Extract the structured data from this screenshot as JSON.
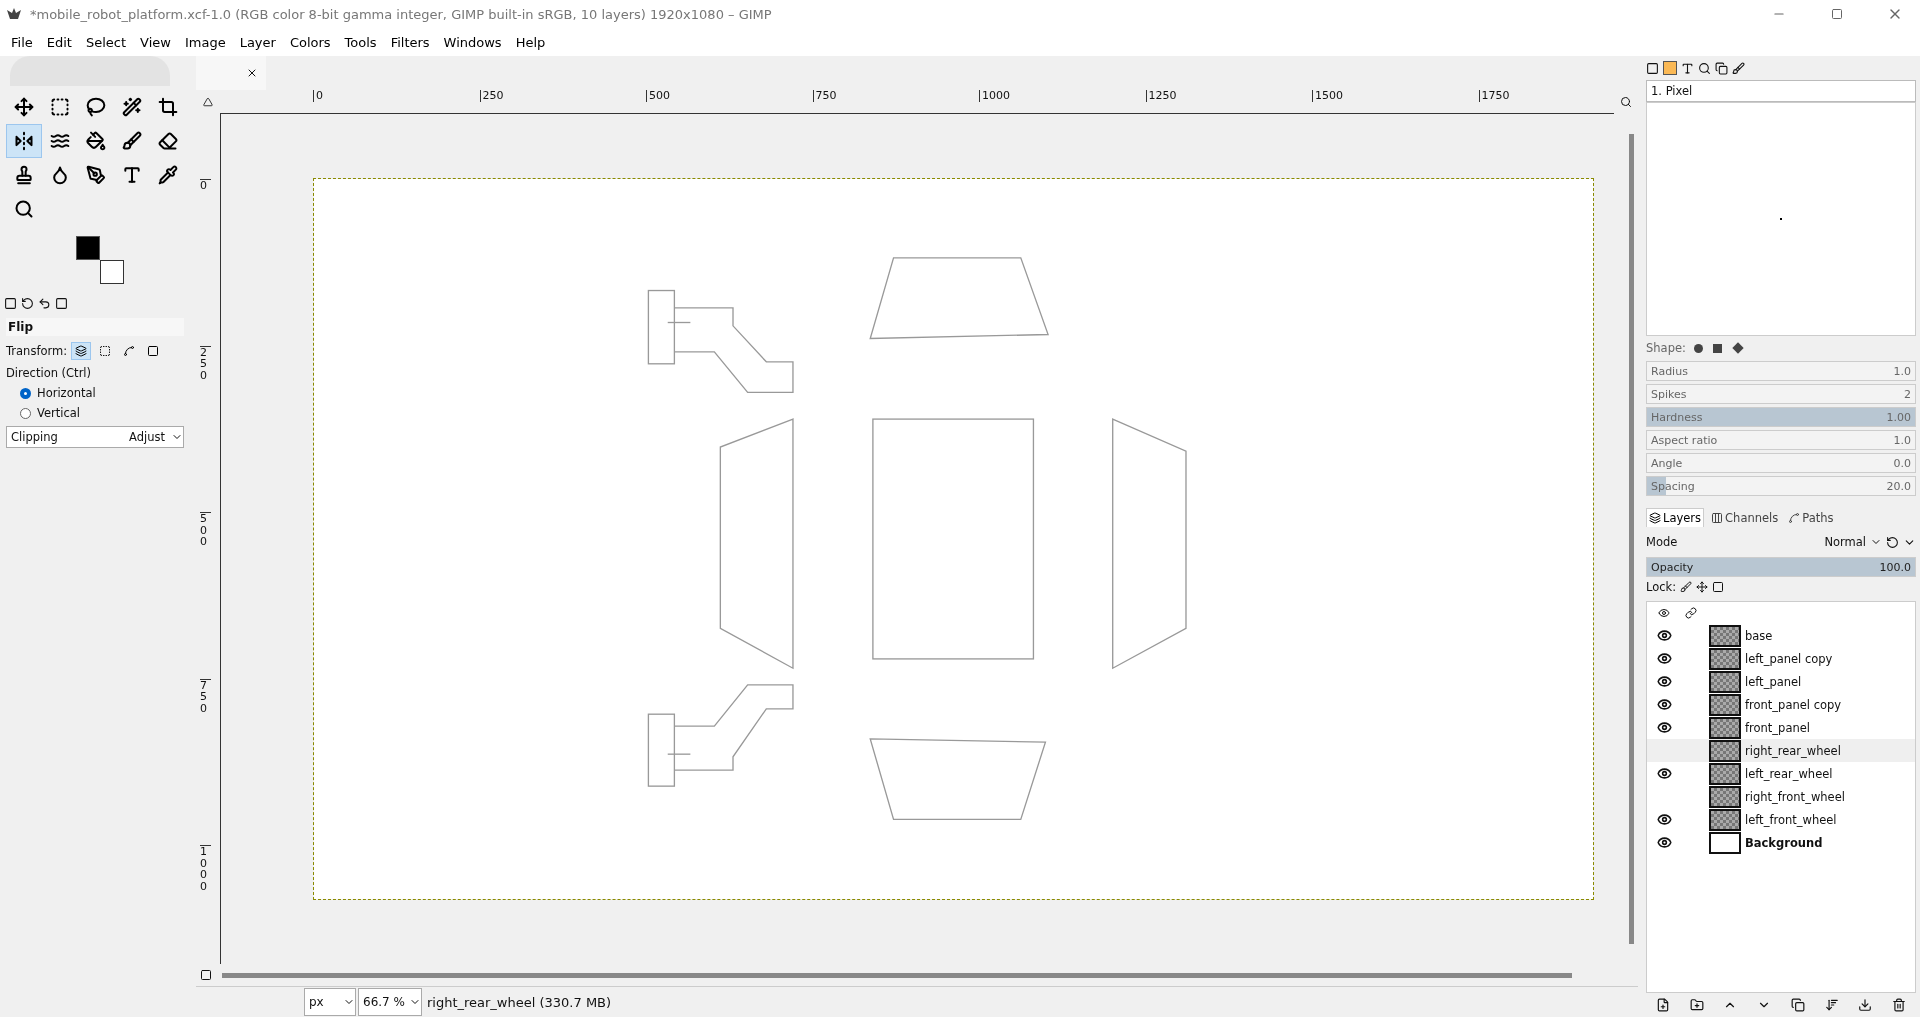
{
  "window": {
    "title": "*mobile_robot_platform.xcf-1.0 (RGB color 8-bit gamma integer, GIMP built-in sRGB, 10 layers) 1920x1080 – GIMP"
  },
  "menu": [
    "File",
    "Edit",
    "Select",
    "View",
    "Image",
    "Layer",
    "Colors",
    "Tools",
    "Filters",
    "Windows",
    "Help"
  ],
  "tools": [
    {
      "selected": false
    },
    {
      "selected": false
    },
    {
      "selected": false
    },
    {
      "selected": false
    },
    {
      "selected": false
    },
    {
      "selected": true
    },
    {
      "selected": false
    },
    {
      "selected": false
    },
    {
      "selected": false
    },
    {
      "selected": false
    },
    {
      "selected": false
    },
    {
      "selected": false
    },
    {
      "selected": false
    },
    {
      "selected": false
    },
    {
      "selected": false
    },
    {
      "selected": false
    }
  ],
  "tool_options": {
    "title": "Flip",
    "transform_label": "Transform:",
    "transform_modes": [
      {
        "selected": true
      },
      {
        "selected": false
      },
      {
        "selected": false
      },
      {
        "selected": false
      }
    ],
    "direction_label": "Direction  (Ctrl)",
    "directions": [
      {
        "label": "Horizontal",
        "selected": true
      },
      {
        "label": "Vertical",
        "selected": false
      }
    ],
    "clipping": {
      "label": "Clipping",
      "value": "Adjust"
    }
  },
  "rulers": {
    "horizontal": [
      "0",
      "250",
      "500",
      "750",
      "1000",
      "1250",
      "1500",
      "1750"
    ],
    "vertical": [
      "0",
      "250",
      "500",
      "750",
      "1000"
    ]
  },
  "brush_panel": {
    "brush_name": "1. Pixel",
    "shape_label": "Shape:",
    "sliders": [
      {
        "label": "Radius",
        "value": "1.0",
        "level": 0
      },
      {
        "label": "Spikes",
        "value": "2",
        "level": 0
      },
      {
        "label": "Hardness",
        "value": "1.00",
        "level": 1
      },
      {
        "label": "Aspect ratio",
        "value": "1.0",
        "level": 0
      },
      {
        "label": "Angle",
        "value": "0.0",
        "level": 0
      },
      {
        "label": "Spacing",
        "value": "20.0",
        "level": 0.07
      }
    ]
  },
  "layers_panel": {
    "tabs": [
      {
        "label": "Layers",
        "selected": true
      },
      {
        "label": "Channels",
        "selected": false
      },
      {
        "label": "Paths",
        "selected": false
      }
    ],
    "mode_label": "Mode",
    "mode_value": "Normal",
    "opacity": {
      "label": "Opacity",
      "value": "100.0",
      "level": 1
    },
    "lock_label": "Lock:",
    "layers": [
      {
        "name": "base",
        "visible": true,
        "selected": false,
        "has_alpha": true
      },
      {
        "name": "left_panel copy",
        "visible": true,
        "selected": false,
        "has_alpha": true
      },
      {
        "name": "left_panel",
        "visible": true,
        "selected": false,
        "has_alpha": true
      },
      {
        "name": "front_panel copy",
        "visible": true,
        "selected": false,
        "has_alpha": true
      },
      {
        "name": "front_panel",
        "visible": true,
        "selected": false,
        "has_alpha": true
      },
      {
        "name": "right_rear_wheel",
        "visible": false,
        "selected": true,
        "has_alpha": true
      },
      {
        "name": "left_rear_wheel",
        "visible": true,
        "selected": false,
        "has_alpha": true
      },
      {
        "name": "right_front_wheel",
        "visible": false,
        "selected": false,
        "has_alpha": true
      },
      {
        "name": "left_front_wheel",
        "visible": true,
        "selected": false,
        "has_alpha": true
      },
      {
        "name": "Background",
        "visible": true,
        "selected": false,
        "has_alpha": false
      }
    ]
  },
  "status_bar": {
    "unit": "px",
    "zoom": "66.7 %",
    "info": "right_rear_wheel (330.7 MB)"
  }
}
